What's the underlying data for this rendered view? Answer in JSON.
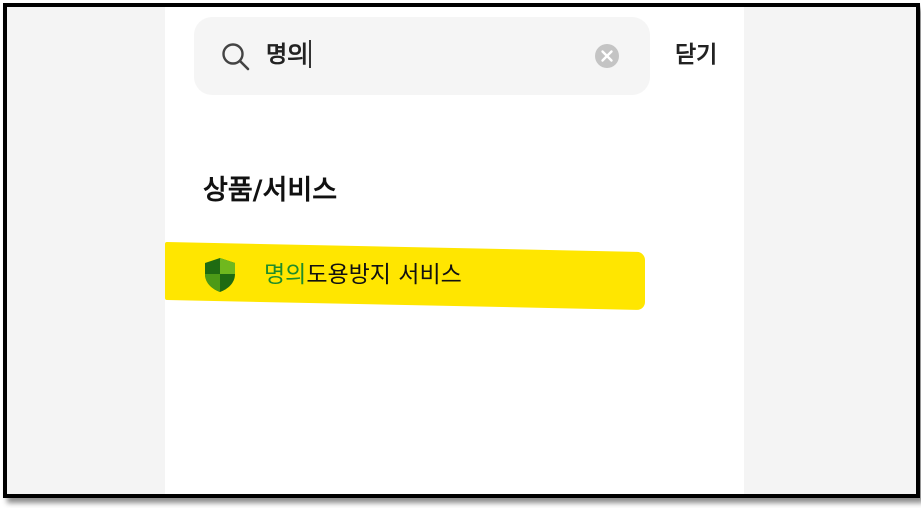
{
  "search": {
    "query": "명의",
    "close_label": "닫기"
  },
  "results": {
    "section_title": "상품/서비스",
    "items": [
      {
        "match_text": "명의",
        "rest_text": "도용방지 서비스",
        "icon": "shield-icon"
      }
    ]
  },
  "colors": {
    "highlight": "#ffe600",
    "match_text": "#1e8c2a",
    "shield_dark": "#1f6b12",
    "shield_light": "#6fb81e"
  }
}
